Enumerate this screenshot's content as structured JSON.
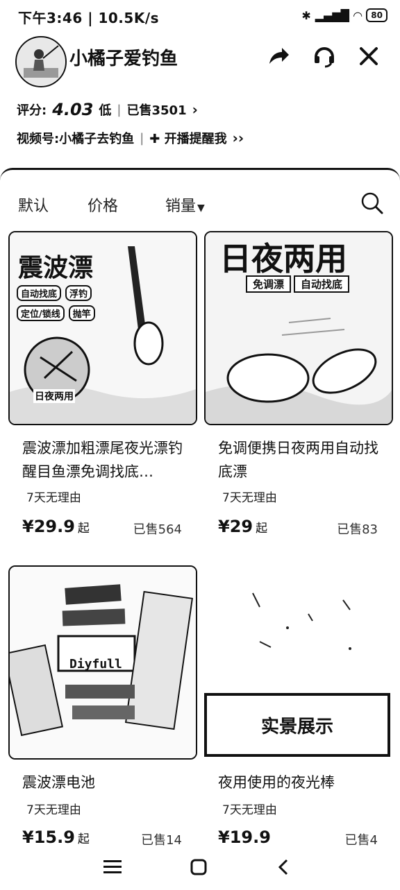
{
  "status_bar": {
    "time": "下午3:46 | 10.5K/s",
    "battery": "80"
  },
  "shop": {
    "name": "小橘子爱钓鱼",
    "rating_label": "评分:",
    "rating_value": "4.03",
    "rating_level": "低",
    "sold_text": "已售3501",
    "video_text": "视频号:小橘子去钓鱼",
    "live_reminder": "开播提醒我"
  },
  "sort_tabs": [
    "默认",
    "价格",
    "销量"
  ],
  "products": [
    {
      "title": "震波漂加粗漂尾夜光漂钓醒目鱼漂免调找底…",
      "tag": "7天无理由",
      "price": "¥29.9",
      "price_suffix": "起",
      "sold": "已售564",
      "image_text": {
        "headline": "震波漂",
        "chips": [
          "自动找底",
          "浮钓",
          "定位/锁线",
          "抛竿"
        ],
        "corner": "日夜两用"
      }
    },
    {
      "title": "免调便携日夜两用自动找底漂",
      "tag": "7天无理由",
      "price": "¥29",
      "price_suffix": "起",
      "sold": "已售83",
      "image_text": {
        "headline": "日夜两用",
        "chips": [
          "免调漂",
          "自动找底"
        ]
      }
    },
    {
      "title": "震波漂电池",
      "tag": "7天无理由",
      "price": "¥15.9",
      "price_suffix": "起",
      "sold": "已售14",
      "image_text": {
        "brand": "Diyfull"
      }
    },
    {
      "title": "夜用使用的夜光棒",
      "tag": "7天无理由",
      "price": "¥19.9",
      "price_suffix": "",
      "sold": "已售4",
      "image_text": {
        "banner": "实景展示"
      }
    }
  ]
}
